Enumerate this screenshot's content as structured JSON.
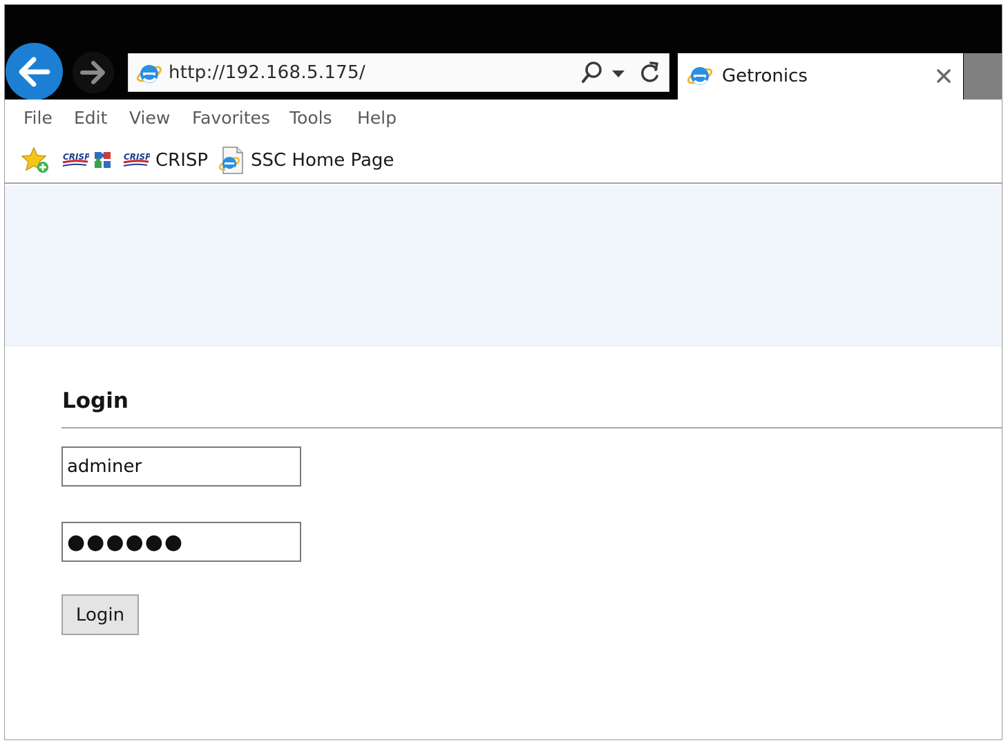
{
  "browser": {
    "address_url": "http://192.168.5.175/",
    "tab_title": "Getronics"
  },
  "menu": {
    "items": [
      "File",
      "Edit",
      "View",
      "Favorites",
      "Tools",
      "Help"
    ]
  },
  "favorites": {
    "crisp_label": "CRISP",
    "ssc_label": "SSC Home Page",
    "crisp_logo_text": "CRISP"
  },
  "login": {
    "heading": "Login",
    "username_value": "adminer",
    "password_mask": "●●●●●●",
    "button_label": "Login"
  },
  "colors": {
    "back_button": "#1d7fd3",
    "chrome": "#030303",
    "banner": "#f1f6fc"
  }
}
